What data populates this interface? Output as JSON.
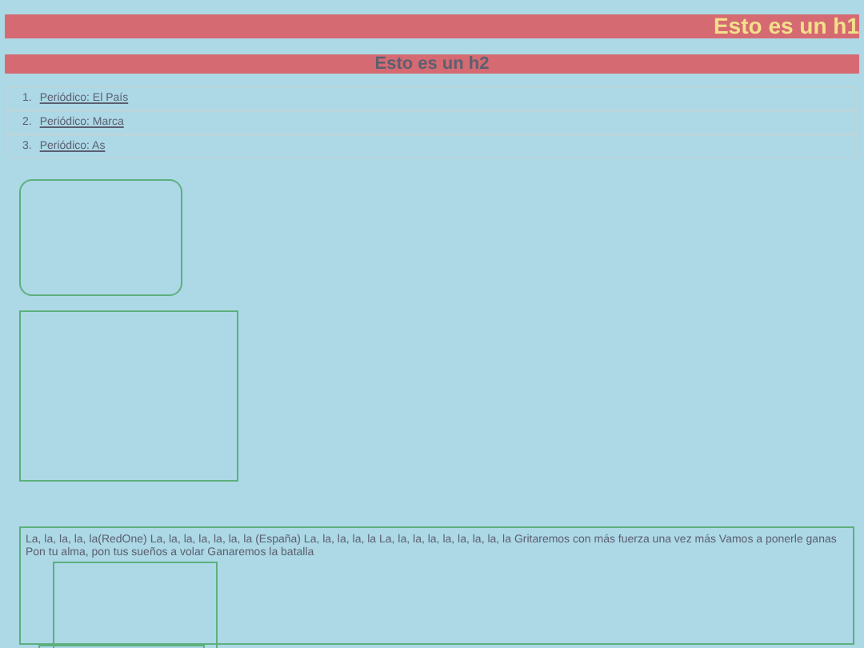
{
  "heading_1": "Esto es un h1",
  "heading_2": "Esto es un h2",
  "links": [
    {
      "number": "1.",
      "label": "Periódico: El País"
    },
    {
      "number": "2.",
      "label": "Periódico: Marca"
    },
    {
      "number": "3.",
      "label": "Periódico: As"
    }
  ],
  "paragraph": "La, la, la, la, la(RedOne) La, la, la, la, la, la, la (España) La, la, la, la, la La, la, la, la, la, la, la, la, la Gritaremos con más fuerza una vez más Vamos a ponerle ganas Pon tu alma, pon tus sueños a volar Ganaremos la batalla"
}
